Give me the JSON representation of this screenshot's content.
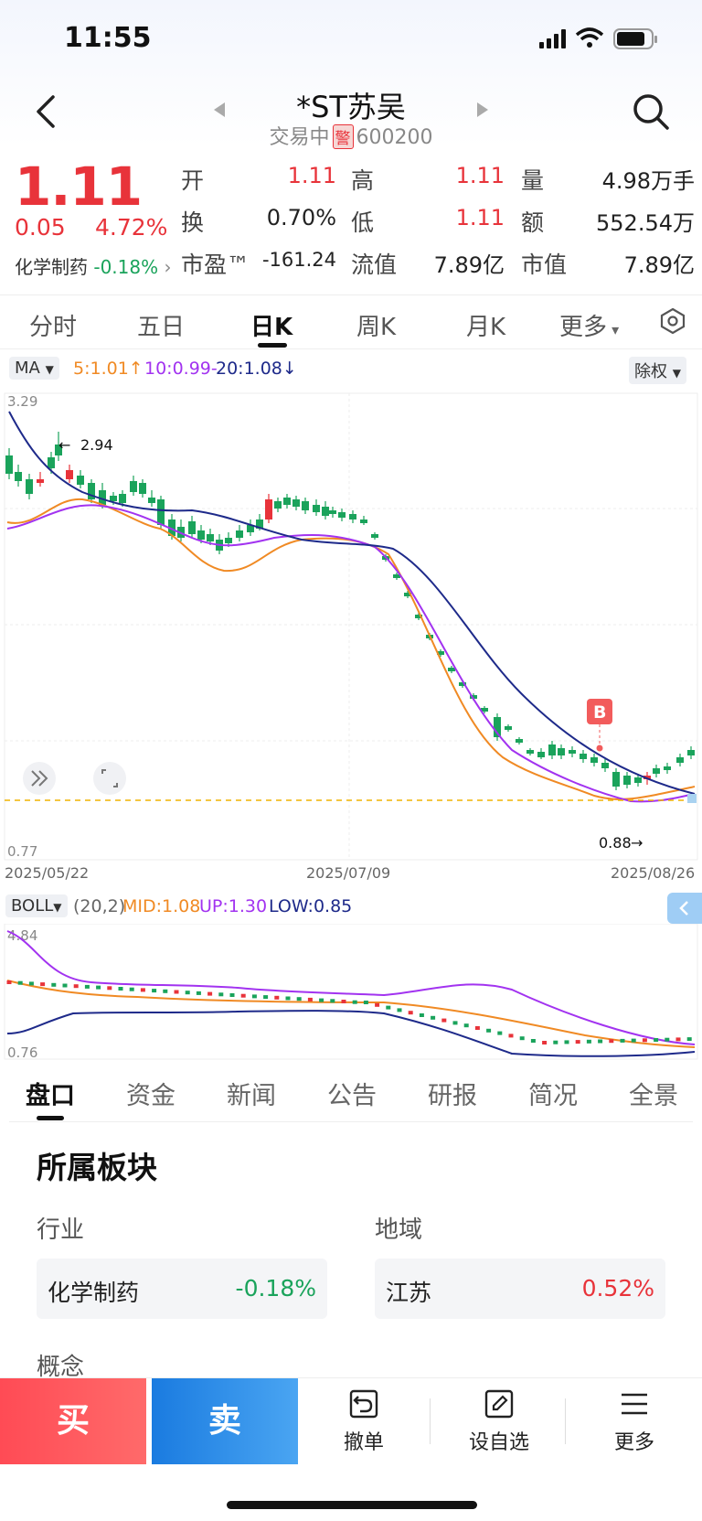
{
  "status": {
    "time": "11:55"
  },
  "header": {
    "title": "*ST苏吴",
    "status_text": "交易中",
    "warn_badge": "警",
    "code": "600200"
  },
  "quote": {
    "price": "1.11",
    "change": "0.05",
    "change_pct": "4.72%",
    "sector_name": "化学制药",
    "sector_pct": "-0.18%",
    "fields": {
      "open_label": "开",
      "open": "1.11",
      "high_label": "高",
      "high": "1.11",
      "volume_label": "量",
      "volume": "4.98万手",
      "turnover_label": "换",
      "turnover": "0.70%",
      "low_label": "低",
      "low": "1.11",
      "amount_label": "额",
      "amount": "552.54万",
      "pe_label": "市盈™",
      "pe": "-161.24",
      "float_cap_label": "流值",
      "float_cap": "7.89亿",
      "mkt_cap_label": "市值",
      "mkt_cap": "7.89亿"
    }
  },
  "chart_tabs": [
    "分时",
    "五日",
    "日K",
    "周K",
    "月K",
    "更多"
  ],
  "ma_legend": {
    "selector": "MA",
    "ma5": "5:1.01",
    "ma10": "10:0.99-",
    "ma20": "20:1.08",
    "adjust": "除权"
  },
  "kline": {
    "top_label": "3.29",
    "bottom_label": "0.77",
    "high_marker": "2.94",
    "low_marker": "0.88",
    "dates": [
      "2025/05/22",
      "2025/07/09",
      "2025/08/26"
    ],
    "signal_badge": "B"
  },
  "boll": {
    "selector": "BOLL",
    "params": "(20,2)",
    "mid": "MID:1.08",
    "up": "UP:1.30",
    "low": "LOW:0.85",
    "top_label": "4.84",
    "bottom_label": "0.76"
  },
  "bottom_tabs": [
    "盘口",
    "资金",
    "新闻",
    "公告",
    "研报",
    "简况",
    "全景"
  ],
  "section": {
    "title": "所属板块",
    "industry_label": "行业",
    "region_label": "地域",
    "industry_name": "化学制药",
    "industry_pct": "-0.18%",
    "region_name": "江苏",
    "region_pct": "0.52%",
    "concept_label": "概念"
  },
  "toolbar": {
    "buy": "买",
    "sell": "卖",
    "cancel": "撤单",
    "watchlist": "设自选",
    "more": "更多"
  },
  "colors": {
    "up": "#e8333a",
    "down": "#1aa35b",
    "ma5": "#f08a24",
    "ma10": "#a233f0",
    "ma20": "#1e2a8a"
  }
}
